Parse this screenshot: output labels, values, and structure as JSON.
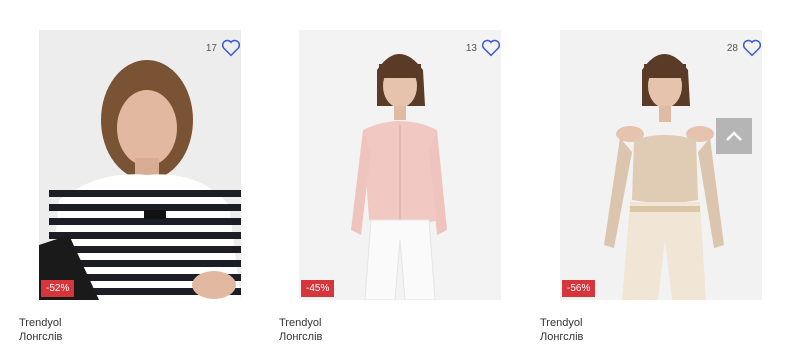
{
  "products": [
    {
      "likes": "17",
      "discount": "-52%",
      "brand": "Trendyol",
      "type": "Лонгслів"
    },
    {
      "likes": "13",
      "discount": "-45%",
      "brand": "Trendyol",
      "type": "Лонгслів"
    },
    {
      "likes": "28",
      "discount": "-56%",
      "brand": "Trendyol",
      "type": "Лонгслів"
    }
  ],
  "icons": {
    "like": "heart-outline-icon",
    "scroll_top": "chevron-up-icon"
  },
  "colors": {
    "heart": "#3a5bd0",
    "discount_badge": "#d6353c",
    "scroll_button": "#b5b5b5"
  }
}
